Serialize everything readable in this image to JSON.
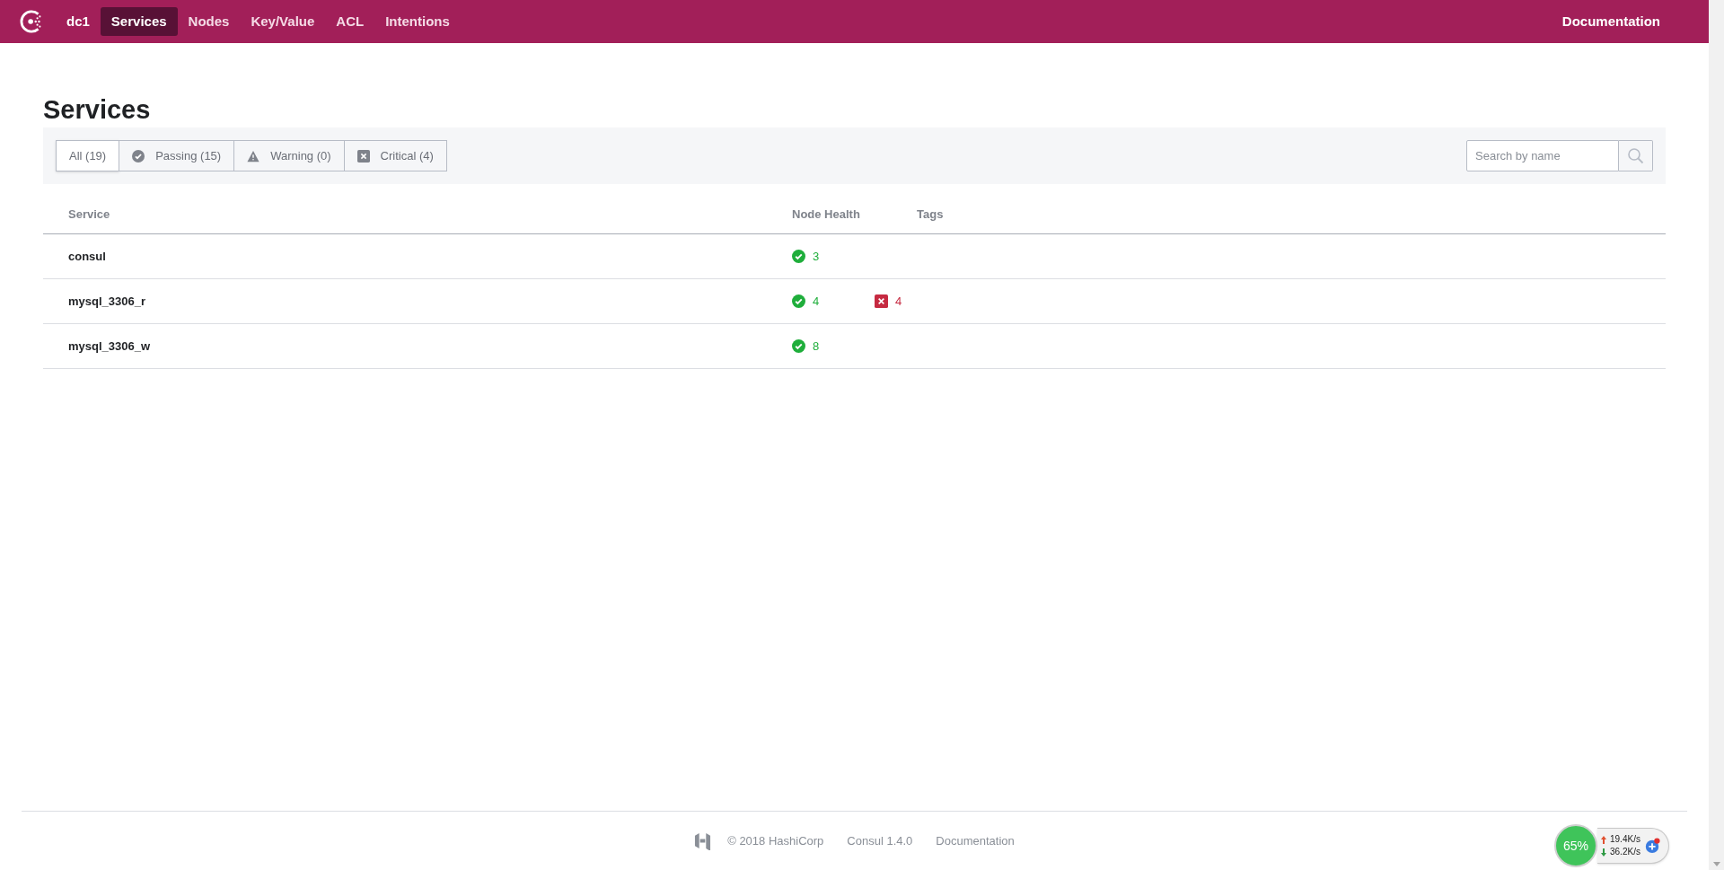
{
  "nav": {
    "datacenter": "dc1",
    "items": [
      {
        "label": "Services",
        "selected": true
      },
      {
        "label": "Nodes",
        "selected": false
      },
      {
        "label": "Key/Value",
        "selected": false
      },
      {
        "label": "ACL",
        "selected": false
      },
      {
        "label": "Intentions",
        "selected": false
      }
    ],
    "right": "Documentation"
  },
  "page_title": "Services",
  "filters": [
    {
      "label": "All (19)",
      "kind": "all",
      "selected": true
    },
    {
      "label": "Passing (15)",
      "kind": "passing",
      "selected": false
    },
    {
      "label": "Warning (0)",
      "kind": "warning",
      "selected": false
    },
    {
      "label": "Critical (4)",
      "kind": "critical",
      "selected": false
    }
  ],
  "search": {
    "placeholder": "Search by name"
  },
  "table": {
    "columns": [
      "Service",
      "Node Health",
      "Tags"
    ],
    "rows": [
      {
        "service": "consul",
        "health": [
          {
            "kind": "passing",
            "count": "3"
          }
        ]
      },
      {
        "service": "mysql_3306_r",
        "health": [
          {
            "kind": "passing",
            "count": "4"
          },
          {
            "kind": "critical",
            "count": "4"
          }
        ]
      },
      {
        "service": "mysql_3306_w",
        "health": [
          {
            "kind": "passing",
            "count": "8"
          }
        ]
      }
    ]
  },
  "footer": {
    "copyright": "© 2018 HashiCorp",
    "version": "Consul 1.4.0",
    "link": "Documentation"
  },
  "net_widget": {
    "percent": "65%",
    "upload": "19.4K/s",
    "download": "36.2K/s"
  }
}
